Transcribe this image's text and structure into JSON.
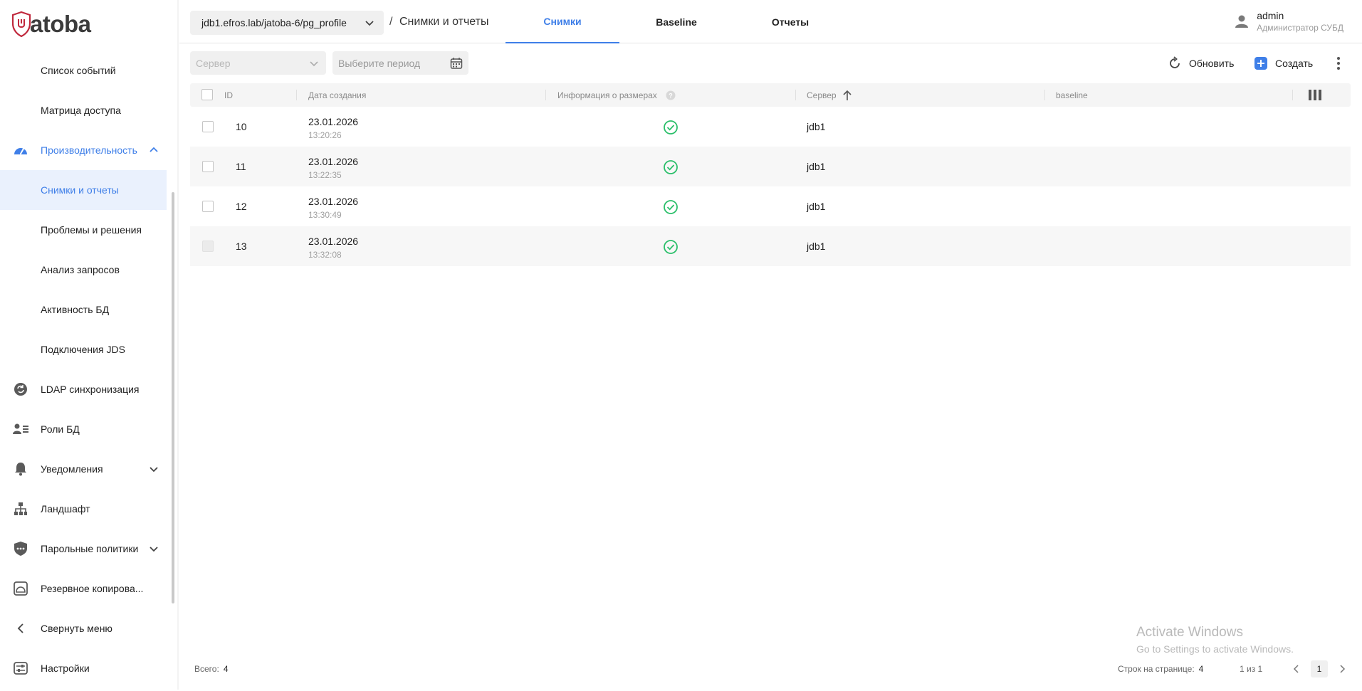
{
  "app": {
    "logo_text": "atoba"
  },
  "sidebar": {
    "items": [
      {
        "label": "Список событий"
      },
      {
        "label": "Матрица доступа"
      },
      {
        "label": "Производительность"
      },
      {
        "label": "Снимки и отчеты"
      },
      {
        "label": "Проблемы и решения"
      },
      {
        "label": "Анализ запросов"
      },
      {
        "label": "Активность БД"
      },
      {
        "label": "Подключения JDS"
      },
      {
        "label": "LDAP синхронизация"
      },
      {
        "label": "Роли БД"
      },
      {
        "label": "Уведомления"
      },
      {
        "label": "Ландшафт"
      },
      {
        "label": "Парольные политики"
      },
      {
        "label": "Резервное копирова..."
      },
      {
        "label": "Свернуть меню"
      },
      {
        "label": "Настройки"
      }
    ]
  },
  "header": {
    "db_path": "jdb1.efros.lab/jatoba-6/pg_profile",
    "breadcrumb_sep": "/",
    "page_title": "Снимки и отчеты",
    "tabs": [
      {
        "label": "Снимки"
      },
      {
        "label": "Baseline"
      },
      {
        "label": "Отчеты"
      }
    ],
    "user": {
      "name": "admin",
      "role": "Администратор СУБД"
    }
  },
  "filters": {
    "server_placeholder": "Сервер",
    "period_placeholder": "Выберите период"
  },
  "actions": {
    "refresh": "Обновить",
    "create": "Создать"
  },
  "table": {
    "columns": [
      "ID",
      "Дата создания",
      "Информация о размерах",
      "Сервер",
      "baseline"
    ],
    "rows": [
      {
        "id": "10",
        "date": "23.01.2026",
        "time": "13:20:26",
        "server": "jdb1"
      },
      {
        "id": "11",
        "date": "23.01.2026",
        "time": "13:22:35",
        "server": "jdb1"
      },
      {
        "id": "12",
        "date": "23.01.2026",
        "time": "13:30:49",
        "server": "jdb1"
      },
      {
        "id": "13",
        "date": "23.01.2026",
        "time": "13:32:08",
        "server": "jdb1"
      }
    ]
  },
  "footer": {
    "total_label": "Всего:",
    "total_value": "4",
    "rows_per_page_label": "Строк на странице:",
    "rows_per_page_value": "4",
    "page_info": "1 из 1",
    "current_page": "1"
  },
  "watermark": {
    "line1": "Activate Windows",
    "line2": "Go to Settings to activate Windows."
  },
  "colors": {
    "accent": "#3f7fe8",
    "success": "#2bbf6a",
    "brand": "#c0283c"
  }
}
